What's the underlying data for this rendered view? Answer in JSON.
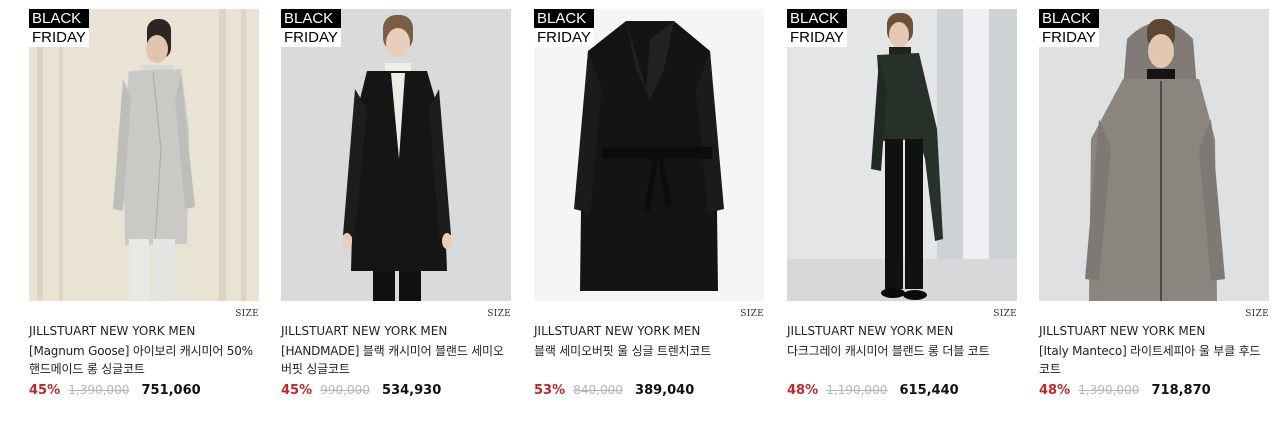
{
  "products": [
    {
      "badge_line1": "BLACK",
      "badge_line2": "FRIDAY",
      "size_label": "SIZE",
      "brand": "JILLSTUART NEW YORK MEN",
      "name": "[Magnum Goose] 아이보리 캐시미어 50% 핸드메이드 롱 싱글코트",
      "discount": "45%",
      "original_price": "1,390,000",
      "sale_price": "751,060",
      "image": "model-light-grey-single-coat"
    },
    {
      "badge_line1": "BLACK",
      "badge_line2": "FRIDAY",
      "size_label": "SIZE",
      "brand": "JILLSTUART NEW YORK MEN",
      "name": "[HANDMADE] 블랙 캐시미어 블랜드 세미오버핏 싱글코트",
      "discount": "45%",
      "original_price": "990,000",
      "sale_price": "534,930",
      "image": "model-black-single-coat"
    },
    {
      "badge_line1": "BLACK",
      "badge_line2": "FRIDAY",
      "size_label": "SIZE",
      "brand": "JILLSTUART NEW YORK MEN",
      "name": "블랙 세미오버핏 울 싱글 트렌치코트",
      "discount": "53%",
      "original_price": "840,000",
      "sale_price": "389,040",
      "image": "flat-black-belted-trench"
    },
    {
      "badge_line1": "BLACK",
      "badge_line2": "FRIDAY",
      "size_label": "SIZE",
      "brand": "JILLSTUART NEW YORK MEN",
      "name": "다크그레이 캐시미어 블랜드 롱 더블 코트",
      "discount": "48%",
      "original_price": "1,190,000",
      "sale_price": "615,440",
      "image": "model-dark-green-long-coat"
    },
    {
      "badge_line1": "BLACK",
      "badge_line2": "FRIDAY",
      "size_label": "SIZE",
      "brand": "JILLSTUART NEW YORK MEN",
      "name": "[Italy Manteco] 라이트세피아 울 부클 후드 코트",
      "discount": "48%",
      "original_price": "1,390,000",
      "sale_price": "718,870",
      "image": "model-grey-hooded-coat"
    }
  ]
}
